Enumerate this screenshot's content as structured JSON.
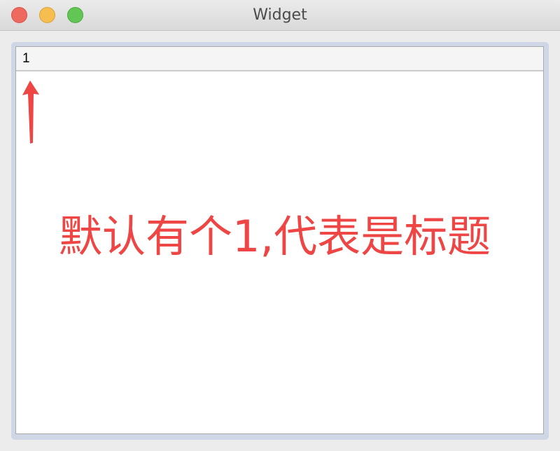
{
  "window": {
    "title": "Widget"
  },
  "header": {
    "section_label": "1"
  },
  "annotation": {
    "text": "默认有个1,代表是标题",
    "color": "#ee4545"
  },
  "icons": {
    "close": "close-icon",
    "minimize": "minimize-icon",
    "maximize": "maximize-icon",
    "arrow": "arrow-up-icon"
  }
}
